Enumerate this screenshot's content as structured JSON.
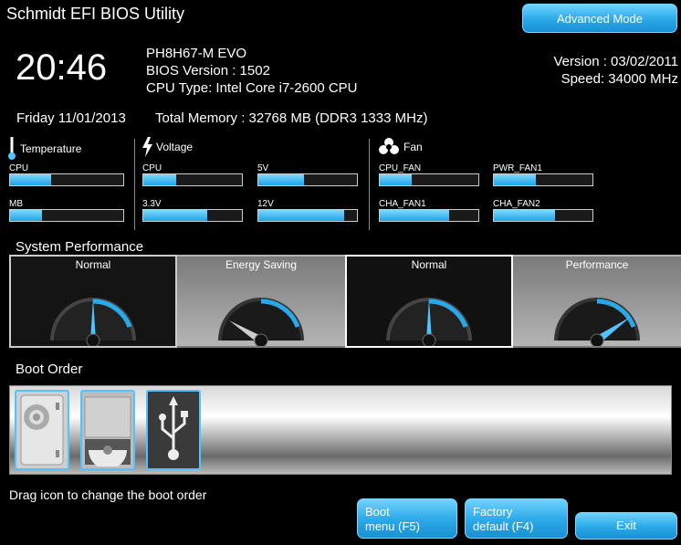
{
  "header": {
    "title": "Schmidt EFI BIOS Utility",
    "advanced_mode_label": "Advanced Mode"
  },
  "system": {
    "time": "20:46",
    "model": "PH8H67-M EVO",
    "bios_version": "BIOS Version : 1502",
    "cpu_type": "CPU Type: Intel Core i7-2600 CPU",
    "version": "Version : 03/02/2011",
    "speed": "Speed: 34000 MHz",
    "date": "Friday 11/01/2013",
    "memory": "Total Memory : 32768 MB (DDR3 1333 MHz)"
  },
  "temperature": {
    "title": "Temperature",
    "icon": "thermometer-icon",
    "sensors": [
      {
        "label": "CPU",
        "level": 0.36
      },
      {
        "label": "MB",
        "level": 0.28
      }
    ]
  },
  "voltage": {
    "title": "Voltage",
    "icon": "lightning-icon",
    "sensors": [
      {
        "label": "CPU",
        "level": 0.33
      },
      {
        "label": "5V",
        "level": 0.46
      },
      {
        "label": "3.3V",
        "level": 0.65
      },
      {
        "label": "12V",
        "level": 0.87
      }
    ]
  },
  "fan": {
    "title": "Fan",
    "icon": "fan-icon",
    "sensors": [
      {
        "label": "CPU_FAN",
        "level": 0.32
      },
      {
        "label": "PWR_FAN1",
        "level": 0.43
      },
      {
        "label": "CHA_FAN1",
        "level": 0.7
      },
      {
        "label": "CHA_FAN2",
        "level": 0.62
      }
    ]
  },
  "performance": {
    "title": "System Performance",
    "modes": [
      {
        "label": "Normal",
        "icon": "gauge-icon"
      },
      {
        "label": "Energy Saving",
        "icon": "gauge-icon"
      },
      {
        "label": "Normal",
        "icon": "gauge-icon"
      },
      {
        "label": "Performance",
        "icon": "gauge-icon"
      }
    ]
  },
  "boot": {
    "title": "Boot Order",
    "devices": [
      {
        "type": "hard-disk",
        "icon": "hard-disk-icon"
      },
      {
        "type": "optical-drive",
        "icon": "optical-drive-icon"
      },
      {
        "type": "usb",
        "icon": "usb-icon"
      }
    ],
    "hint": "Drag icon to change the boot order"
  },
  "footer": {
    "boot_menu_label_1": "Boot",
    "boot_menu_label_2": "menu (F5)",
    "factory_label_1": "Factory",
    "factory_label_2": "default (F4)",
    "exit_label": "Exit"
  },
  "colors": {
    "accent": "#2aa8e8",
    "background": "#000000"
  }
}
